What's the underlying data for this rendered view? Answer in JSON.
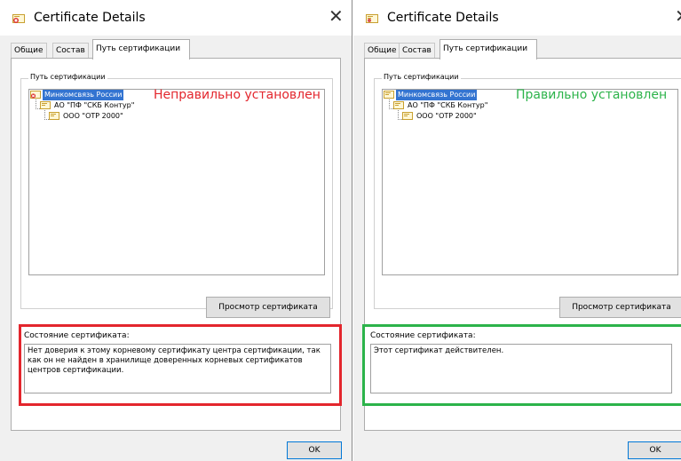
{
  "left": {
    "window_title": "Certificate Details",
    "close_glyph": "✕",
    "tabs": [
      "Общие",
      "Состав",
      "Путь сертификации"
    ],
    "active_tab": 2,
    "group_label": "Путь сертификации",
    "tree": [
      {
        "label": "Минкомсвязь России",
        "selected": true,
        "icon": "root-cert-error-icon"
      },
      {
        "label": "АО \"ПФ \"СКБ Контур\"",
        "selected": false,
        "icon": "certificate-icon"
      },
      {
        "label": "ООО \"ОТР 2000\"",
        "selected": false,
        "icon": "certificate-icon"
      }
    ],
    "annotation": "Неправильно установлен",
    "annotation_color": "#e3262d",
    "view_button": "Просмотр сертификата",
    "status_label": "Состояние сертификата:",
    "status_text": "Нет доверия к этому корневому сертификату центра сертификации, так как он не найден в хранилище доверенных корневых сертификатов центров сертификации.",
    "frame_color": "#e3262d",
    "ok_button": "OK"
  },
  "right": {
    "window_title": "Certificate Details",
    "close_glyph": "✕",
    "tabs": [
      "Общие",
      "Состав",
      "Путь сертификации"
    ],
    "active_tab": 2,
    "group_label": "Путь сертификации",
    "tree": [
      {
        "label": "Минкомсвязь России",
        "selected": true,
        "icon": "root-certificate-icon"
      },
      {
        "label": "АО \"ПФ \"СКБ Контур\"",
        "selected": false,
        "icon": "certificate-icon"
      },
      {
        "label": "ООО \"ОТР 2000\"",
        "selected": false,
        "icon": "certificate-icon"
      }
    ],
    "annotation": "Правильно установлен",
    "annotation_color": "#2cb34a",
    "view_button": "Просмотр сертификата",
    "status_label": "Состояние сертификата:",
    "status_text": "Этот сертификат действителен.",
    "frame_color": "#2cb34a",
    "ok_button": "OK"
  }
}
